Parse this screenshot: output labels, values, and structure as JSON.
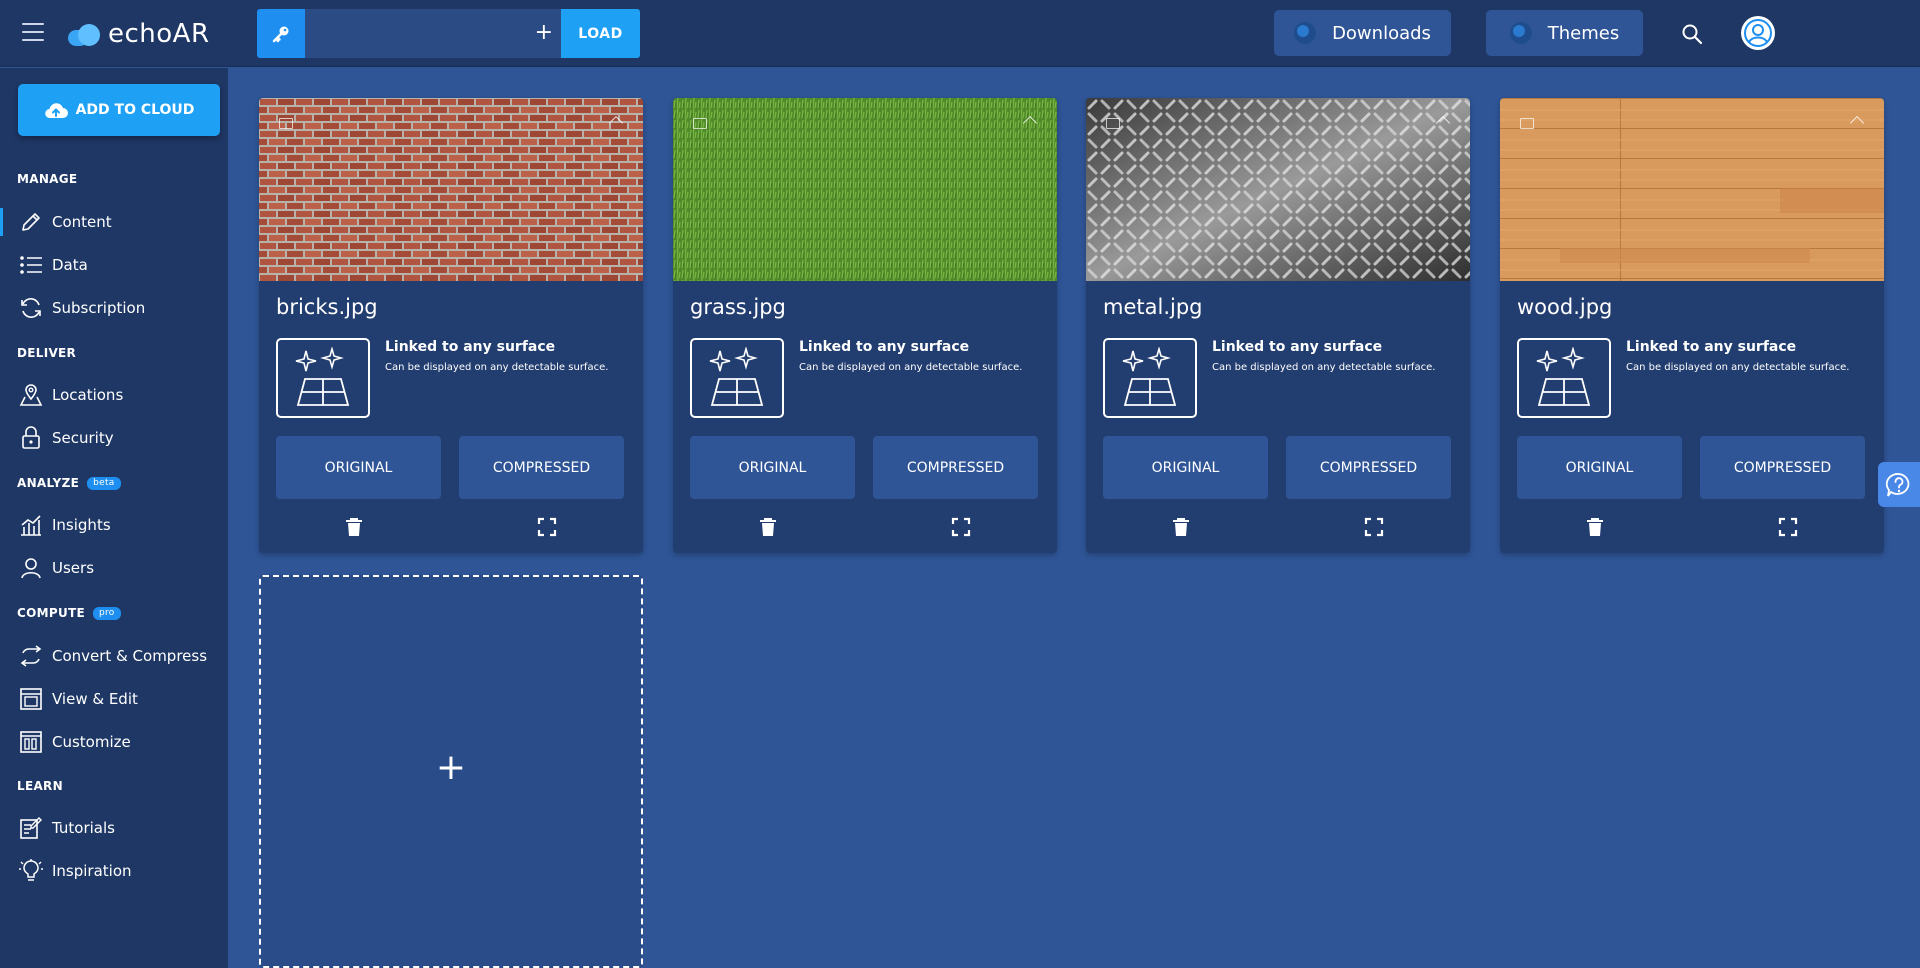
{
  "app": {
    "name": "echoAR"
  },
  "topbar": {
    "load_label": "LOAD",
    "key_input_value": "",
    "plus_glyph": "+",
    "downloads_label": "Downloads",
    "themes_label": "Themes"
  },
  "sidebar": {
    "add_to_cloud_label": "ADD TO CLOUD",
    "sections": {
      "manage": "MANAGE",
      "deliver": "DELIVER",
      "analyze": "ANALYZE",
      "analyze_badge": "beta",
      "compute": "COMPUTE",
      "compute_badge": "pro",
      "learn": "LEARN"
    },
    "items": {
      "content": "Content",
      "data": "Data",
      "subscription": "Subscription",
      "locations": "Locations",
      "security": "Security",
      "insights": "Insights",
      "users": "Users",
      "convert": "Convert & Compress",
      "view_edit": "View & Edit",
      "customize": "Customize",
      "tutorials": "Tutorials",
      "inspiration": "Inspiration"
    },
    "active_item": "Content"
  },
  "cards": [
    {
      "title": "bricks.jpg",
      "surface_title": "Linked to any surface",
      "surface_desc": "Can be displayed on any detectable surface.",
      "original_label": "ORIGINAL",
      "compressed_label": "COMPRESSED",
      "texture": "bricks"
    },
    {
      "title": "grass.jpg",
      "surface_title": "Linked to any surface",
      "surface_desc": "Can be displayed on any detectable surface.",
      "original_label": "ORIGINAL",
      "compressed_label": "COMPRESSED",
      "texture": "grass"
    },
    {
      "title": "metal.jpg",
      "surface_title": "Linked to any surface",
      "surface_desc": "Can be displayed on any detectable surface.",
      "original_label": "ORIGINAL",
      "compressed_label": "COMPRESSED",
      "texture": "metal"
    },
    {
      "title": "wood.jpg",
      "surface_title": "Linked to any surface",
      "surface_desc": "Can be displayed on any detectable surface.",
      "original_label": "ORIGINAL",
      "compressed_label": "COMPRESSED",
      "texture": "wood"
    }
  ],
  "add_card": {
    "plus_glyph": "+"
  },
  "help": {
    "icon": "help-icon"
  },
  "colors": {
    "topbar": "#1f3765",
    "sidebar": "#1f3765",
    "main_bg": "#2f5597",
    "card_bg": "#223d6f",
    "accent": "#1ea0f5"
  }
}
